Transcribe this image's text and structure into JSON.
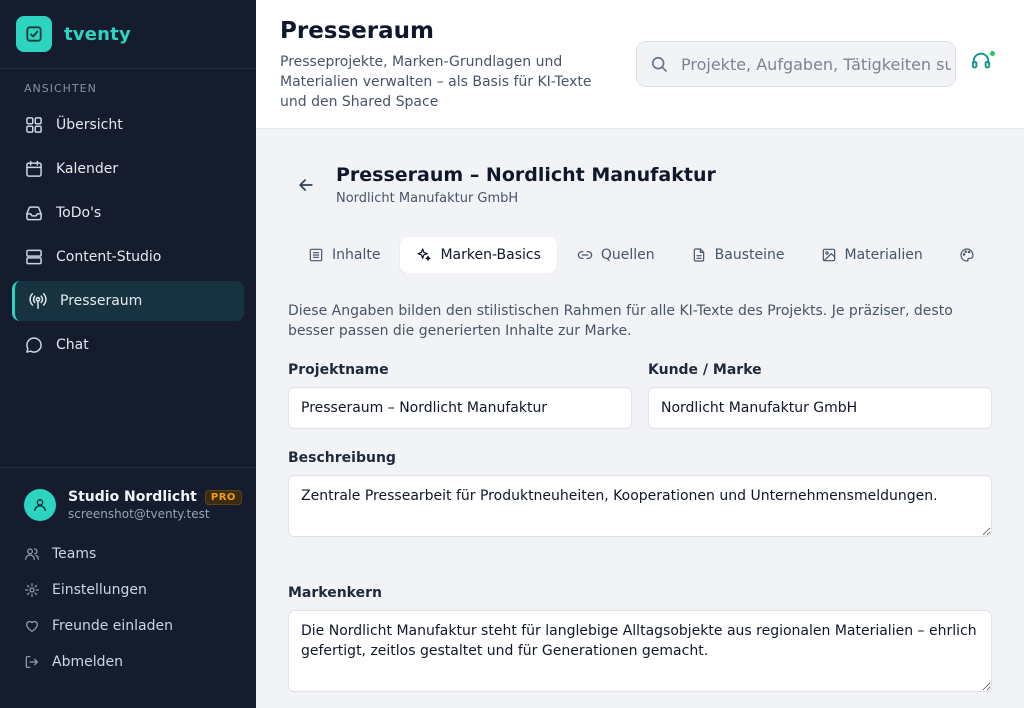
{
  "app": {
    "name": "tventy"
  },
  "sidebar": {
    "section_label": "ANSICHTEN",
    "items": [
      {
        "label": "Übersicht",
        "icon": "grid-icon"
      },
      {
        "label": "Kalender",
        "icon": "calendar-icon"
      },
      {
        "label": "ToDo's",
        "icon": "inbox-icon"
      },
      {
        "label": "Content-Studio",
        "icon": "layers-icon"
      },
      {
        "label": "Presseraum",
        "icon": "broadcast-icon",
        "active": true
      },
      {
        "label": "Chat",
        "icon": "chat-icon"
      }
    ],
    "user": {
      "name": "Studio Nordlicht",
      "badge": "PRO",
      "email": "screenshot@tventy.test"
    },
    "bottom_items": [
      {
        "label": "Teams",
        "icon": "users-icon"
      },
      {
        "label": "Einstellungen",
        "icon": "gear-icon"
      },
      {
        "label": "Freunde einladen",
        "icon": "heart-icon"
      },
      {
        "label": "Abmelden",
        "icon": "logout-icon"
      }
    ]
  },
  "header": {
    "title": "Presseraum",
    "subtitle": "Presseprojekte, Marken-Grundlagen und Materialien verwalten – als Basis für KI-Texte und den Shared Space",
    "search_placeholder": "Projekte, Aufgaben, Tätigkeiten suchen",
    "search_value": ""
  },
  "project": {
    "title": "Presseraum – Nordlicht Manufaktur",
    "client": "Nordlicht Manufaktur GmbH"
  },
  "tabs": [
    {
      "label": "Inhalte",
      "icon": "list-icon"
    },
    {
      "label": "Marken-Basics",
      "icon": "sparkle-icon",
      "active": true
    },
    {
      "label": "Quellen",
      "icon": "link-icon"
    },
    {
      "label": "Bausteine",
      "icon": "document-icon"
    },
    {
      "label": "Materialien",
      "icon": "image-icon"
    },
    {
      "label": "",
      "icon": "palette-icon"
    }
  ],
  "form": {
    "intro": "Diese Angaben bilden den stilistischen Rahmen für alle KI-Texte des Projekts. Je präziser, desto besser passen die generierten Inhalte zur Marke.",
    "project_name_label": "Projektname",
    "project_name_value": "Presseraum – Nordlicht Manufaktur",
    "client_label": "Kunde / Marke",
    "client_value": "Nordlicht Manufaktur GmbH",
    "description_label": "Beschreibung",
    "description_value": "Zentrale Pressearbeit für Produktneuheiten, Kooperationen und Unternehmensmeldungen.",
    "brand_core_label": "Markenkern",
    "brand_core_value": "Die Nordlicht Manufaktur steht für langlebige Alltagsobjekte aus regionalen Materialien – ehrlich gefertigt, zeitlos gestaltet und für Generationen gemacht."
  },
  "colors": {
    "accent": "#2dd4bf",
    "sidebar_bg": "#141c2d",
    "active_bg": "#173340",
    "pro": "#f59e0b"
  }
}
